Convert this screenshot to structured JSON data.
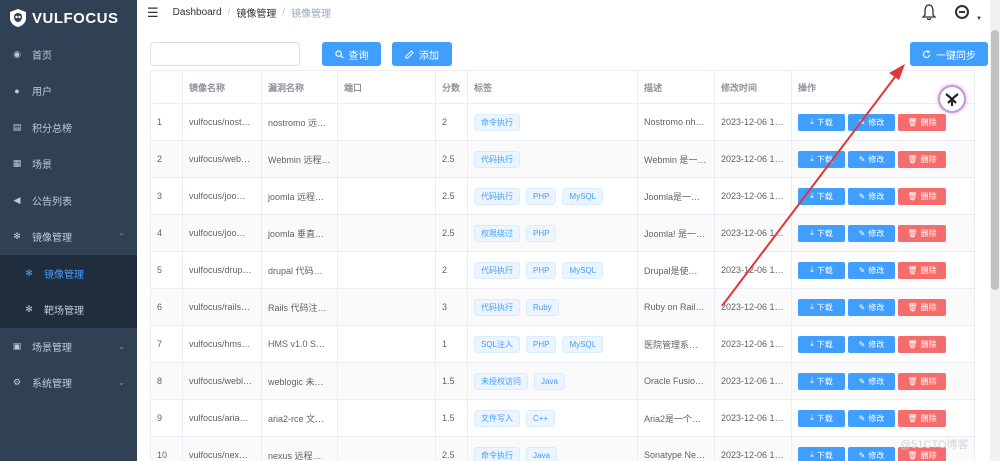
{
  "app": {
    "name": "VULFOCUS"
  },
  "sidebar": {
    "items": [
      {
        "label": "首页",
        "icon": "dashboard-icon"
      },
      {
        "label": "用户",
        "icon": "user-icon"
      },
      {
        "label": "积分总榜",
        "icon": "document-icon"
      },
      {
        "label": "场景",
        "icon": "table-icon"
      },
      {
        "label": "公告列表",
        "icon": "megaphone-icon"
      },
      {
        "label": "镜像管理",
        "icon": "bug-icon",
        "expanded": true
      },
      {
        "label": "镜像管理",
        "icon": "bug-icon",
        "sub": true,
        "active": true
      },
      {
        "label": "靶场管理",
        "icon": "bug-icon",
        "sub": true
      },
      {
        "label": "场景管理",
        "icon": "scene-icon",
        "collapsed": true
      },
      {
        "label": "系统管理",
        "icon": "gear-icon",
        "collapsed": true
      }
    ]
  },
  "breadcrumb": {
    "items": [
      "Dashboard",
      "镜像管理",
      "镜像管理"
    ]
  },
  "toolbar": {
    "search_placeholder": "",
    "search_value": "",
    "query_label": "查询",
    "add_label": "添加",
    "sync_label": "一键同步"
  },
  "table": {
    "headers": [
      "",
      "镜像名称",
      "漏洞名称",
      "端口",
      "分数",
      "标签",
      "描述",
      "修改时间",
      "操作"
    ],
    "rows": [
      {
        "id": "1",
        "image": "vulfocus/nost…",
        "vuln": "nostromo 远…",
        "port": "",
        "score": "2",
        "tags": [
          "命令执行"
        ],
        "desc": "Nostromo nh…",
        "time": "2023-12-06 1…"
      },
      {
        "id": "2",
        "image": "vulfocus/web…",
        "vuln": "Webmin 远程…",
        "port": "",
        "score": "2.5",
        "tags": [
          "代码执行"
        ],
        "desc": "Webmin 是一…",
        "time": "2023-12-06 1…"
      },
      {
        "id": "3",
        "image": "vulfocus/joo…",
        "vuln": "joomla 远程…",
        "port": "",
        "score": "2.5",
        "tags": [
          "代码执行",
          "PHP",
          "MySQL"
        ],
        "desc": "Joomla是一…",
        "time": "2023-12-06 1…"
      },
      {
        "id": "4",
        "image": "vulfocus/joo…",
        "vuln": "joomla 垂直…",
        "port": "",
        "score": "2.5",
        "tags": [
          "权限绕过",
          "PHP"
        ],
        "desc": "Joomla! 是一…",
        "time": "2023-12-06 1…"
      },
      {
        "id": "5",
        "image": "vulfocus/drup…",
        "vuln": "drupal 代码…",
        "port": "",
        "score": "2",
        "tags": [
          "代码执行",
          "PHP",
          "MySQL"
        ],
        "desc": "Drupal是使…",
        "time": "2023-12-06 1…"
      },
      {
        "id": "6",
        "image": "vulfocus/rails…",
        "vuln": "Rails 代码注…",
        "port": "",
        "score": "3",
        "tags": [
          "代码执行",
          "Ruby"
        ],
        "desc": "Ruby on Rail…",
        "time": "2023-12-06 1…"
      },
      {
        "id": "7",
        "image": "vulfocus/hms…",
        "vuln": "HMS v1.0 S…",
        "port": "",
        "score": "1",
        "tags": [
          "SQL注入",
          "PHP",
          "MySQL"
        ],
        "desc": "医院管理系…",
        "time": "2023-12-06 1…"
      },
      {
        "id": "8",
        "image": "vulfocus/webl…",
        "vuln": "weblogic 未…",
        "port": "",
        "score": "1.5",
        "tags": [
          "未授权访问",
          "Java"
        ],
        "desc": "Oracle Fusio…",
        "time": "2023-12-06 1…"
      },
      {
        "id": "9",
        "image": "vulfocus/aria…",
        "vuln": "aria2-rce 文…",
        "port": "",
        "score": "1.5",
        "tags": [
          "文件写入",
          "C++"
        ],
        "desc": "Aria2是一个…",
        "time": "2023-12-06 1…"
      },
      {
        "id": "10",
        "image": "vulfocus/nex…",
        "vuln": "nexus 远程…",
        "port": "",
        "score": "2.5",
        "tags": [
          "命令执行",
          "Java"
        ],
        "desc": "Sonatype Ne…",
        "time": "2023-12-06 1…"
      }
    ],
    "actions": {
      "download": "下载",
      "edit": "修改",
      "delete": "删除"
    }
  },
  "watermark": "@51CTO博客",
  "colors": {
    "sidebar_bg": "#304156",
    "primary": "#409eff",
    "danger": "#f56c6c",
    "arrow": "#e0373b"
  }
}
